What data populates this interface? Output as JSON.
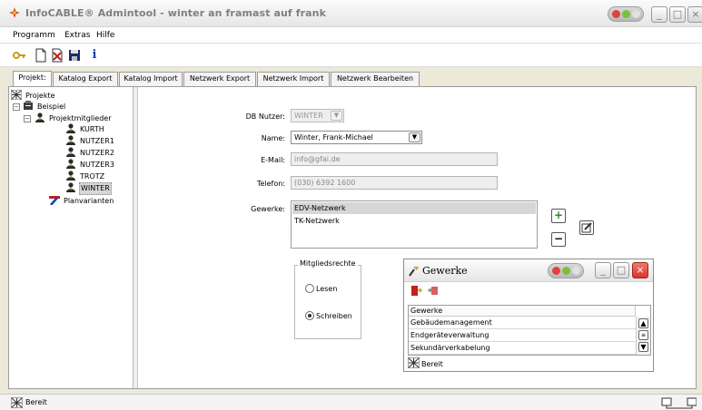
{
  "window": {
    "title": "InfoCABLE® Admintool - winter an framast auf frank"
  },
  "menu": [
    "Programm",
    "Extras",
    "Hilfe"
  ],
  "toolbar": {
    "info_label": "i"
  },
  "tabs": [
    {
      "label": "Projekt:",
      "active": true
    },
    {
      "label": "Katalog Export",
      "active": false
    },
    {
      "label": "Katalog Import",
      "active": false
    },
    {
      "label": "Netzwerk Export",
      "active": false
    },
    {
      "label": "Netzwerk Import",
      "active": false
    },
    {
      "label": "Netzwerk Bearbeiten",
      "active": false
    }
  ],
  "tree": {
    "root": "Projekte",
    "project": "Beispiel",
    "members_node": "Projektmitglieder",
    "members": [
      "KURTH",
      "NUTZER1",
      "NUTZER2",
      "NUTZER3",
      "TROTZ",
      "WINTER"
    ],
    "selected": "WINTER",
    "variants_node": "Planvarianten"
  },
  "form": {
    "db_user_label": "DB Nutzer:",
    "db_user_value": "WINTER",
    "name_label": "Name:",
    "name_value": "Winter, Frank-Michael",
    "email_label": "E-Mail:",
    "email_value": "info@gfai.de",
    "phone_label": "Telefon:",
    "phone_value": "(030) 6392 1600",
    "trades_label": "Gewerke:",
    "trades": [
      "EDV-Netzwerk",
      "TK-Netzwerk"
    ],
    "trades_selected": "EDV-Netzwerk",
    "add_label": "+",
    "remove_label": "−"
  },
  "rights": {
    "title": "Mitgliedsrechte",
    "read_label": "Lesen",
    "write_label": "Schreiben",
    "selected": "Schreiben"
  },
  "gewerke_window": {
    "title": "Gewerke",
    "column_header": "Gewerke",
    "rows": [
      "Gebäudemanagement",
      "Endgeräteverwaltung",
      "Sekundärverkabelung"
    ],
    "status": "Bereit"
  },
  "statusbar": {
    "text": "Bereit"
  },
  "colors": {
    "title_text": "#7f7f7f",
    "selection": "#d6d6d6",
    "add_green": "#2e8b2e",
    "close_red": "#d9362b"
  }
}
